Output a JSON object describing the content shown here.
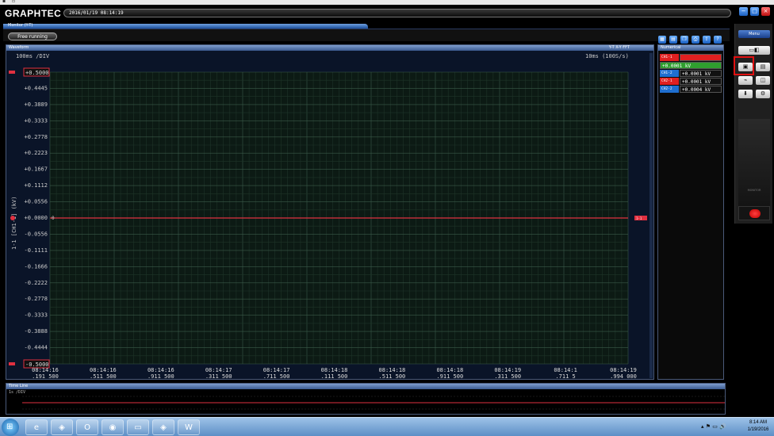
{
  "app": {
    "brand": "GRAPHTEC",
    "datetime": "2016/01/19 08:14:19"
  },
  "window_controls": [
    "−",
    "□",
    "×"
  ],
  "top_tabbar": {
    "label": "Monitor (Y-T)"
  },
  "toolbar": {
    "free_running": "Free running",
    "icons": [
      "display-icon",
      "grid-icon",
      "copy-icon",
      "print-icon",
      "export-icon",
      "help-icon"
    ]
  },
  "waveform": {
    "title": "Waveform",
    "view_tabs": "Y-T  X-Y  FFT",
    "timescale_left": "100ms /DIV",
    "timescale_right": "10ms (100S/s)",
    "axis_label": "1-1 [CH1-1] (kV)",
    "top_marker": "+0.5000",
    "bottom_marker": "-0.5000",
    "y_ticks": [
      "+0.4445",
      "+0.3889",
      "+0.3333",
      "+0.2778",
      "+0.2223",
      "+0.1667",
      "+0.1112",
      "+0.0556",
      "+0.0000",
      "-0.0556",
      "-0.1111",
      "-0.1666",
      "-0.2222",
      "-0.2778",
      "-0.3333",
      "-0.3888",
      "-0.4444"
    ],
    "x_ticks": [
      {
        "t": "08:14:16",
        "ms": ".191 500"
      },
      {
        "t": "08:14:16",
        "ms": ".511 500"
      },
      {
        "t": "08:14:16",
        "ms": ".911 500"
      },
      {
        "t": "08:14:17",
        "ms": ".311 500"
      },
      {
        "t": "08:14:17",
        "ms": ".711 500"
      },
      {
        "t": "08:14:18",
        "ms": ".111 500"
      },
      {
        "t": "08:14:18",
        "ms": ".511 500"
      },
      {
        "t": "08:14:18",
        "ms": ".911 500"
      },
      {
        "t": "08:14:19",
        "ms": ".311 500"
      },
      {
        "t": "08:14:1",
        "ms": ".711 5"
      },
      {
        "t": "08:14:19",
        "ms": ".994 000"
      }
    ],
    "zero_marker": "0",
    "trace_color": "#e03040",
    "trigger_label": "1-1"
  },
  "numerical": {
    "title": "Numerical",
    "rows": [
      {
        "ch": "CH1-1  CH1-1",
        "value": "",
        "color": "#e02020"
      },
      {
        "ch": "",
        "value": "+0.0001 kV",
        "color": "#2f9f2f"
      },
      {
        "ch": "CH1-2",
        "value": "+0.0001 kV",
        "color": "#1f6fd0"
      },
      {
        "ch": "CH2-1",
        "value": "+0.0001 kV",
        "color": "#e02020"
      },
      {
        "ch": "CH2-2",
        "value": "+0.0004 kV",
        "color": "#1f6fd0"
      }
    ]
  },
  "timeline": {
    "title": "Time Line",
    "scale": "1s  /DIV"
  },
  "sidebar": {
    "menu_label": "Menu",
    "small_label": "MONITOR"
  },
  "taskbar": {
    "apps": [
      "ie-icon",
      "graphtec-icon",
      "outlook-icon",
      "chrome-icon",
      "explorer-icon",
      "graphtec-icon",
      "word-icon"
    ],
    "time": "8:14 AM",
    "date": "1/19/2016"
  }
}
